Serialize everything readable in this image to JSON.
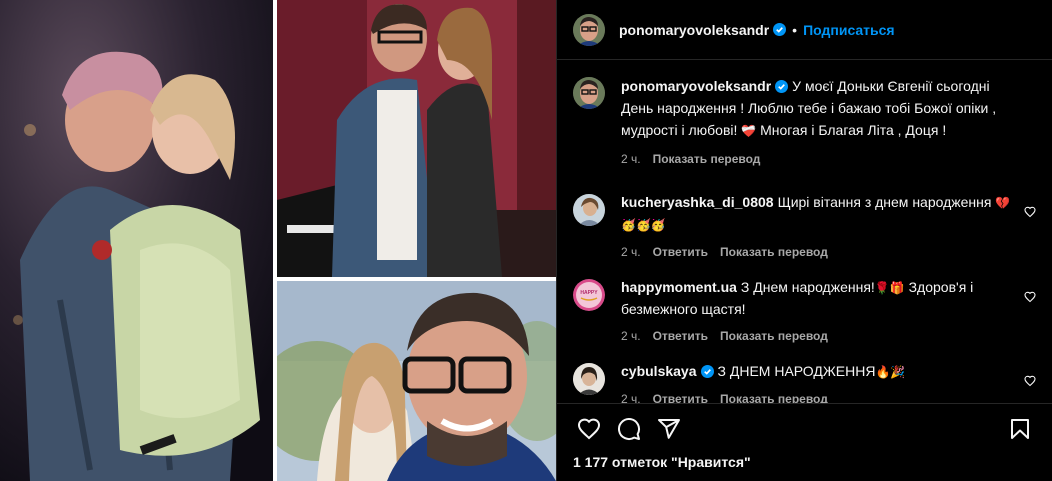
{
  "post": {
    "author": "ponomaryovoleksandr",
    "separator": "•",
    "follow_label": "Подписаться",
    "caption": {
      "username": "ponomaryovoleksandr",
      "text": "У моєї Доньки Євгенії сьогодні День народження ! Люблю тебе і бажаю тобі Божої опіки , мудрості і любові!",
      "emoji": "❤️‍🩹",
      "text_after": "Многая і Благая Літа , Доця !",
      "time": "2 ч.",
      "translate_label": "Показать перевод"
    }
  },
  "comments": [
    {
      "username": "kucheryashka_di_0808",
      "text": "Щирі вітання з днем народження",
      "emoji": "💔",
      "emoji_line": "🥳🥳🥳",
      "time": "2 ч.",
      "reply_label": "Ответить",
      "translate_label": "Показать перевод",
      "verified": false
    },
    {
      "username": "happymoment.ua",
      "text": "З Днем народження!",
      "emoji": "🌹🎁",
      "text_after": "Здоров'я і безмежного щастя!",
      "time": "2 ч.",
      "reply_label": "Ответить",
      "translate_label": "Показать перевод",
      "avatar_text": "HAPPY",
      "verified": false
    },
    {
      "username": "cybulskaya",
      "text": "З ДНЕМ НАРОДЖЕННЯ",
      "emoji": "🔥🎉",
      "time": "2 ч.",
      "reply_label": "Ответить",
      "translate_label": "Показать перевод",
      "verified": true
    }
  ],
  "actions": {
    "likes_text": "1 177 отметок \"Нравится\""
  },
  "colors": {
    "background": "#000000",
    "accent": "#0095f6",
    "muted": "#a8a8a8",
    "divider": "#262626",
    "heart_red": "#ed4956"
  },
  "icons": [
    "heart-icon",
    "comment-icon",
    "share-icon",
    "bookmark-icon",
    "verified-icon"
  ]
}
